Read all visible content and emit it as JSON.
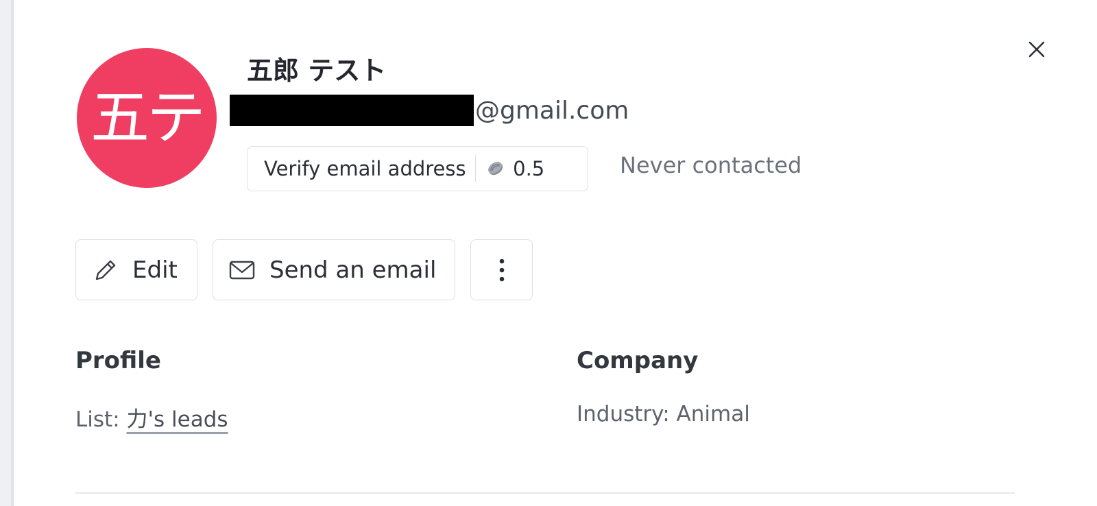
{
  "contact": {
    "avatar_initials": "五テ",
    "name": "五郎 テスト",
    "email_domain": "@gmail.com",
    "contact_status": "Never contacted"
  },
  "verify": {
    "label": "Verify email address",
    "credit_cost": "0.5"
  },
  "actions": {
    "edit_label": "Edit",
    "send_email_label": "Send an email"
  },
  "profile": {
    "title": "Profile",
    "list_prefix": "List: ",
    "list_value": "力's leads"
  },
  "company": {
    "title": "Company",
    "industry_text": "Industry: Animal"
  },
  "icons": {
    "close": "close-icon",
    "credit": "credit-icon",
    "edit": "pencil-icon",
    "email": "envelope-icon",
    "more": "more-vertical-icon"
  },
  "colors": {
    "avatar_bg": "#ef3e62",
    "panel_bg": "#ffffff",
    "border": "#dcdfe5",
    "muted_text": "#6b717b"
  }
}
